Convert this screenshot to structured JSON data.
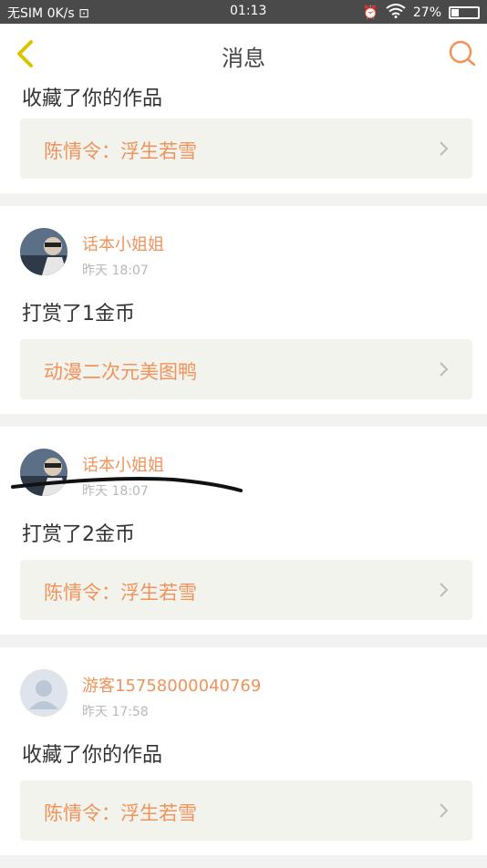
{
  "status_bar": {
    "sim": "无SIM",
    "speed": "0K/s",
    "time": "01:13",
    "battery": "27%",
    "battery_level": 0.27
  },
  "header": {
    "title": "消息"
  },
  "messages": [
    {
      "action": "收藏了你的作品",
      "work_title": "陈情令：浮生若雪"
    },
    {
      "user": "话本小姐姐",
      "time": "昨天 18:07",
      "action": "打赏了1金币",
      "work_title": "动漫二次元美图鸭"
    },
    {
      "user": "话本小姐姐",
      "time": "昨天 18:07",
      "action": "打赏了2金币",
      "work_title": "陈情令：浮生若雪"
    },
    {
      "user": "游客15758000040769",
      "time": "昨天 17:58",
      "action": "收藏了你的作品",
      "work_title": "陈情令：浮生若雪"
    }
  ],
  "colors": {
    "accent": "#f0935a",
    "back_arrow": "#d8c400",
    "card_bg": "#ffffff",
    "work_bg": "#f3f3ee",
    "page_bg": "#f2f2f0"
  }
}
